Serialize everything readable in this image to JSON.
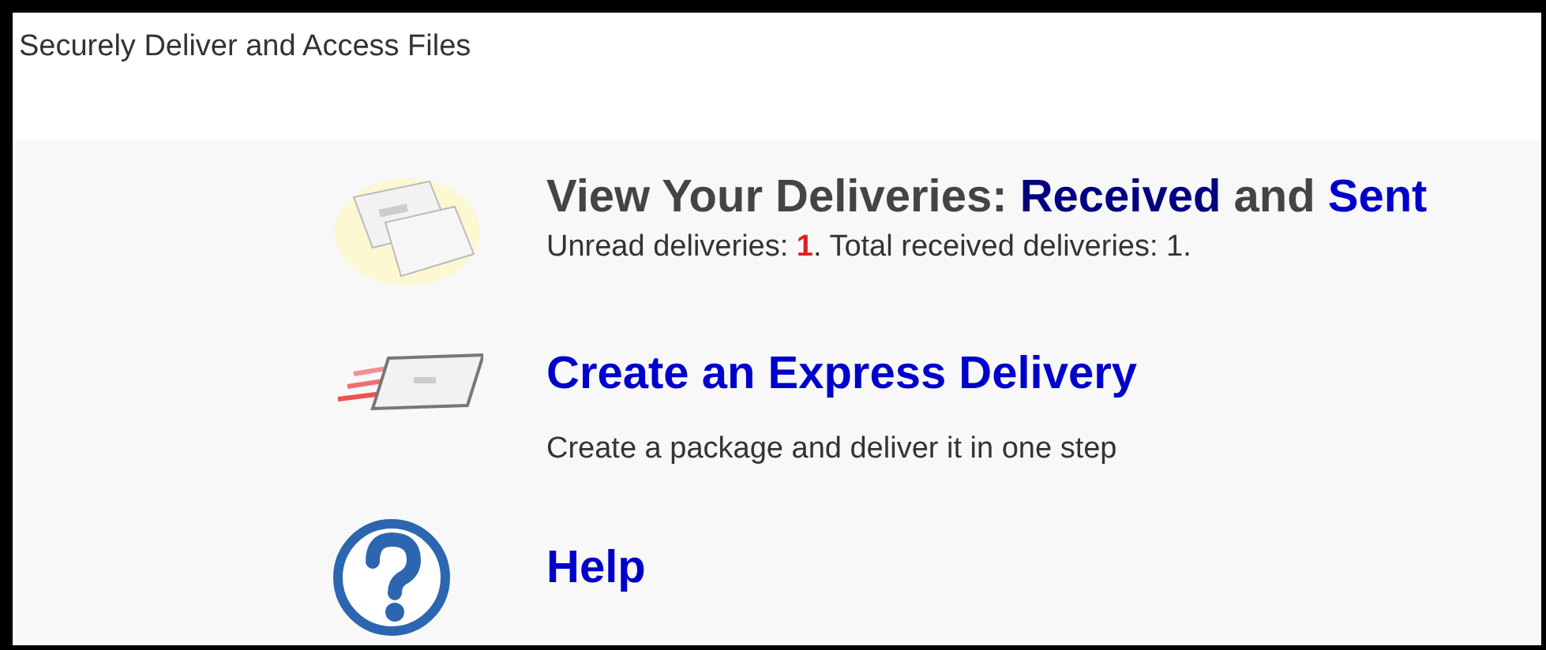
{
  "header": {
    "title": "Securely Deliver and Access Files"
  },
  "sections": [
    {
      "kind": "envelopes",
      "heading": [
        {
          "kind": "text",
          "text": "View Your Deliveries: "
        },
        {
          "kind": "link",
          "text": "Received",
          "color": "#000080"
        },
        {
          "kind": "text",
          "text": " and "
        },
        {
          "kind": "link",
          "text": "Sent",
          "color": "#0000cc"
        }
      ],
      "details": [
        {
          "kind": "text",
          "text": "Unread deliveries: "
        },
        {
          "kind": "count",
          "text": "1"
        },
        {
          "kind": "text",
          "text": ". Total received deliveries: 1."
        }
      ]
    },
    {
      "kind": "express",
      "heading": [
        {
          "kind": "link",
          "text": "Create an Express Delivery",
          "color": "#0000cc"
        }
      ],
      "details": [
        {
          "kind": "text",
          "text": "Create a package and deliver it in one step"
        }
      ]
    },
    {
      "kind": "help",
      "heading": [
        {
          "kind": "link",
          "text": "Help",
          "color": "#0000cc"
        }
      ]
    }
  ]
}
